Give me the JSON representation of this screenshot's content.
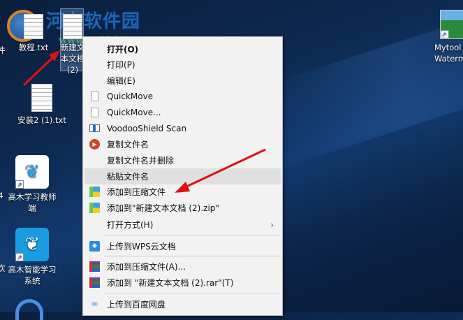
{
  "desktop": {
    "icons": [
      {
        "label": "教程.txt"
      },
      {
        "label": "新建文本文档 (2)"
      },
      {
        "label": "安装2 (1).txt"
      },
      {
        "label": "高木学习教师端"
      },
      {
        "label": "高木智能学习系统"
      },
      {
        "label": "Mytool Watermark"
      }
    ],
    "partial_left_labels": [
      "件",
      "4",
      "欢"
    ]
  },
  "watermark": {
    "site_name": "河东软件园",
    "url": "www.pc0359.cn"
  },
  "context_menu": {
    "items": [
      {
        "label": "打开(O)",
        "icon": ""
      },
      {
        "label": "打印(P)",
        "icon": ""
      },
      {
        "label": "编辑(E)",
        "icon": ""
      },
      {
        "label": "QuickMove",
        "icon": "file-icon"
      },
      {
        "label": "QuickMove...",
        "icon": "file-icon"
      },
      {
        "label": "VoodooShield Scan",
        "icon": "voodooshield-icon"
      },
      {
        "label": "复制文件名",
        "icon": "red-play-icon"
      },
      {
        "label": "复制文件名并删除",
        "icon": ""
      },
      {
        "label": "粘贴文件名",
        "icon": "",
        "highlighted": true
      },
      {
        "label": "添加到压缩文件",
        "icon": "zip-icon"
      },
      {
        "label": "添加到\"新建文本文档 (2).zip\"",
        "icon": "zip-icon"
      },
      {
        "label": "打开方式(H)",
        "icon": "",
        "submenu": true
      },
      {
        "label": "上传到WPS云文档",
        "icon": "wps-cloud-icon"
      },
      {
        "label": "添加到压缩文件(A)...",
        "icon": "winrar-icon"
      },
      {
        "label": "添加到 \"新建文本文档 (2).rar\"(T)",
        "icon": "winrar-icon"
      },
      {
        "label": "上传到百度网盘",
        "icon": "baidu-netdisk-icon"
      }
    ]
  }
}
